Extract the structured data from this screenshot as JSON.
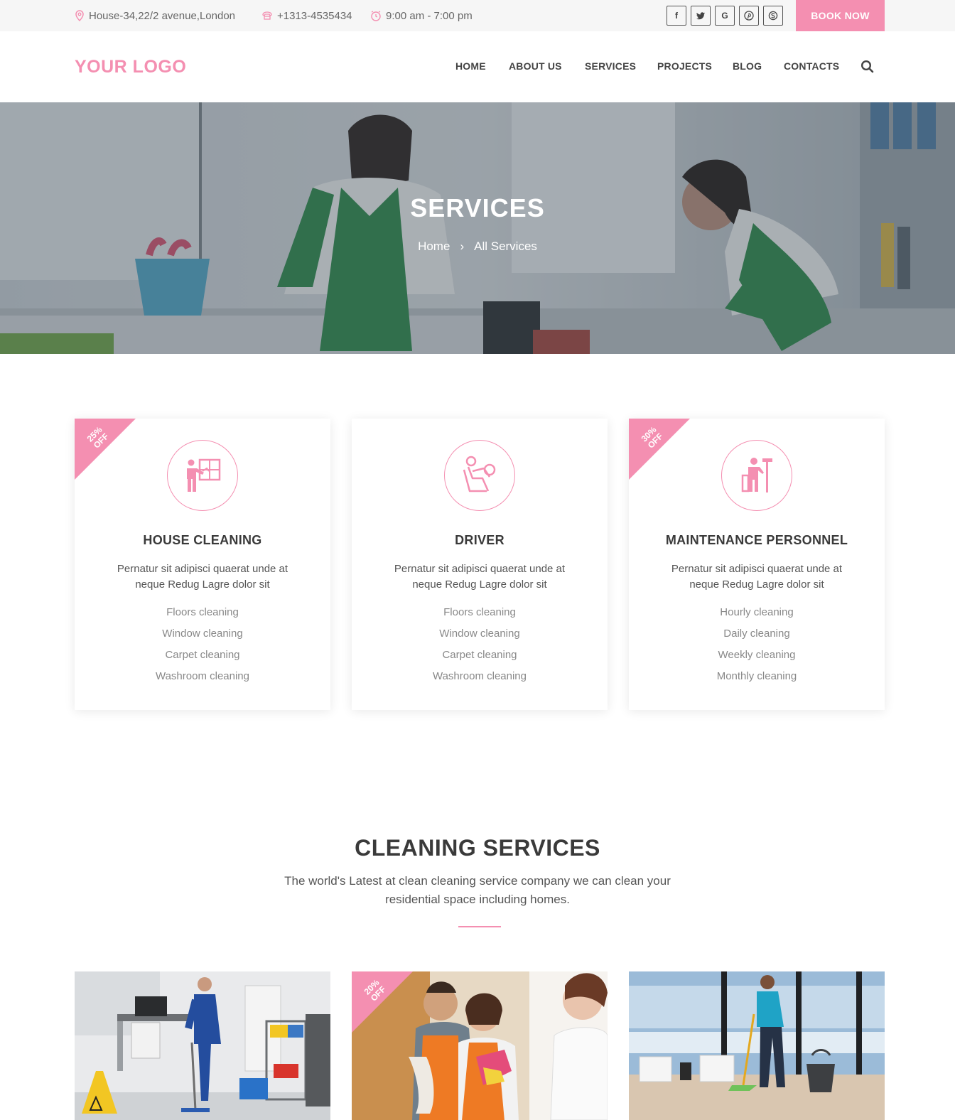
{
  "topbar": {
    "address": "House-34,22/2 avenue,London",
    "phone": "+1313-4535434",
    "hours": "9:00 am - 7:00 pm",
    "socials": [
      {
        "icon": "facebook-icon",
        "glyph": "f"
      },
      {
        "icon": "twitter-icon",
        "glyph": "t"
      },
      {
        "icon": "google-icon",
        "glyph": "G"
      },
      {
        "icon": "pinterest-icon",
        "glyph": "P"
      },
      {
        "icon": "skype-icon",
        "glyph": "S"
      }
    ],
    "book_label": "BOOK NOW"
  },
  "header": {
    "logo": "YOUR LOGO",
    "nav": [
      "HOME",
      "ABOUT US",
      "SERVICES",
      "PROJECTS",
      "BLOG",
      "CONTACTS"
    ]
  },
  "hero": {
    "title": "SERVICES",
    "breadcrumb": {
      "home": "Home",
      "separator": "›",
      "current": "All Services"
    }
  },
  "services": [
    {
      "badge": "25%\nOFF",
      "icon": "window-cleaner-icon",
      "title": "HOUSE CLEANING",
      "desc": "Pernatur sit adipisci quaerat unde at neque Redug Lagre dolor sit",
      "items": [
        "Floors cleaning",
        "Window cleaning",
        "Carpet cleaning",
        "Washroom cleaning"
      ]
    },
    {
      "badge": "",
      "icon": "driver-icon",
      "title": "DRIVER",
      "desc": "Pernatur sit adipisci quaerat unde at neque Redug Lagre dolor sit",
      "items": [
        "Floors cleaning",
        "Window cleaning",
        "Carpet cleaning",
        "Washroom cleaning"
      ]
    },
    {
      "badge": "30%\nOFF",
      "icon": "maintenance-icon",
      "title": "MAINTENANCE PERSONNEL",
      "desc": "Pernatur sit adipisci quaerat unde at neque Redug Lagre dolor sit",
      "items": [
        "Hourly cleaning",
        "Daily cleaning",
        "Weekly cleaning",
        "Monthly cleaning"
      ]
    }
  ],
  "cleaning_section": {
    "title": "CLEANING SERVICES",
    "desc": "The world's Latest at clean cleaning service company we can clean your residential space including homes.",
    "photo_badge": "20%\nOFF"
  },
  "colors": {
    "accent": "#f48fb1",
    "text": "#444444",
    "muted": "#888888"
  }
}
